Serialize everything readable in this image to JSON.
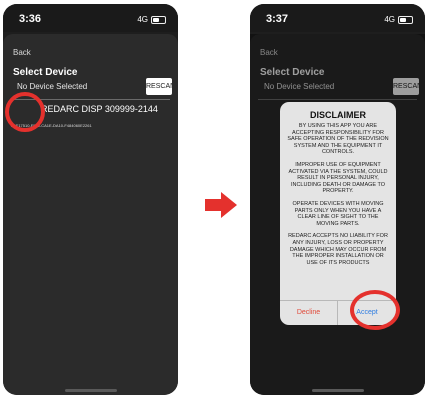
{
  "accent_color": "#e4312d",
  "screen1": {
    "status": {
      "time": "3:36",
      "network": "4G"
    },
    "back_label": "Back",
    "title": "Select Device",
    "no_device": "No Device Selected",
    "rescan_label": "RESCAN",
    "device": {
      "name": "REDARC DISP 309999-2144",
      "id": "E9F17510-F539-CA1E-DA10-F484060E2261"
    }
  },
  "screen2": {
    "status": {
      "time": "3:37",
      "network": "4G"
    },
    "back_label": "Back",
    "title": "Select Device",
    "no_device": "No Device Selected",
    "rescan_label": "RESCAN",
    "dialog": {
      "title": "DISCLAIMER",
      "paragraphs": [
        "BY USING THIS APP YOU ARE ACCEPTING RESPONSIBILITY FOR SAFE OPERATION OF THE REDVISION SYSTEM AND THE EQUIPMENT IT CONTROLS.",
        "IMPROPER USE OF EQUIPMENT ACTIVATED VIA THE SYSTEM, COULD RESULT IN PERSONAL INJURY, INCLUDING DEATH OR DAMAGE TO PROPERTY.",
        "OPERATE DEVICES WITH MOVING PARTS ONLY WHEN YOU HAVE A CLEAR LINE OF SIGHT TO THE MOVING PARTS.",
        "REDARC ACCEPTS NO LIABILITY FOR ANY INJURY, LOSS OR PROPERTY DAMAGE WHICH MAY OCCUR FROM THE IMPROPER INSTALLATION OR USE OF ITS PRODUCTS"
      ],
      "decline_label": "Decline",
      "accept_label": "Accept"
    }
  }
}
